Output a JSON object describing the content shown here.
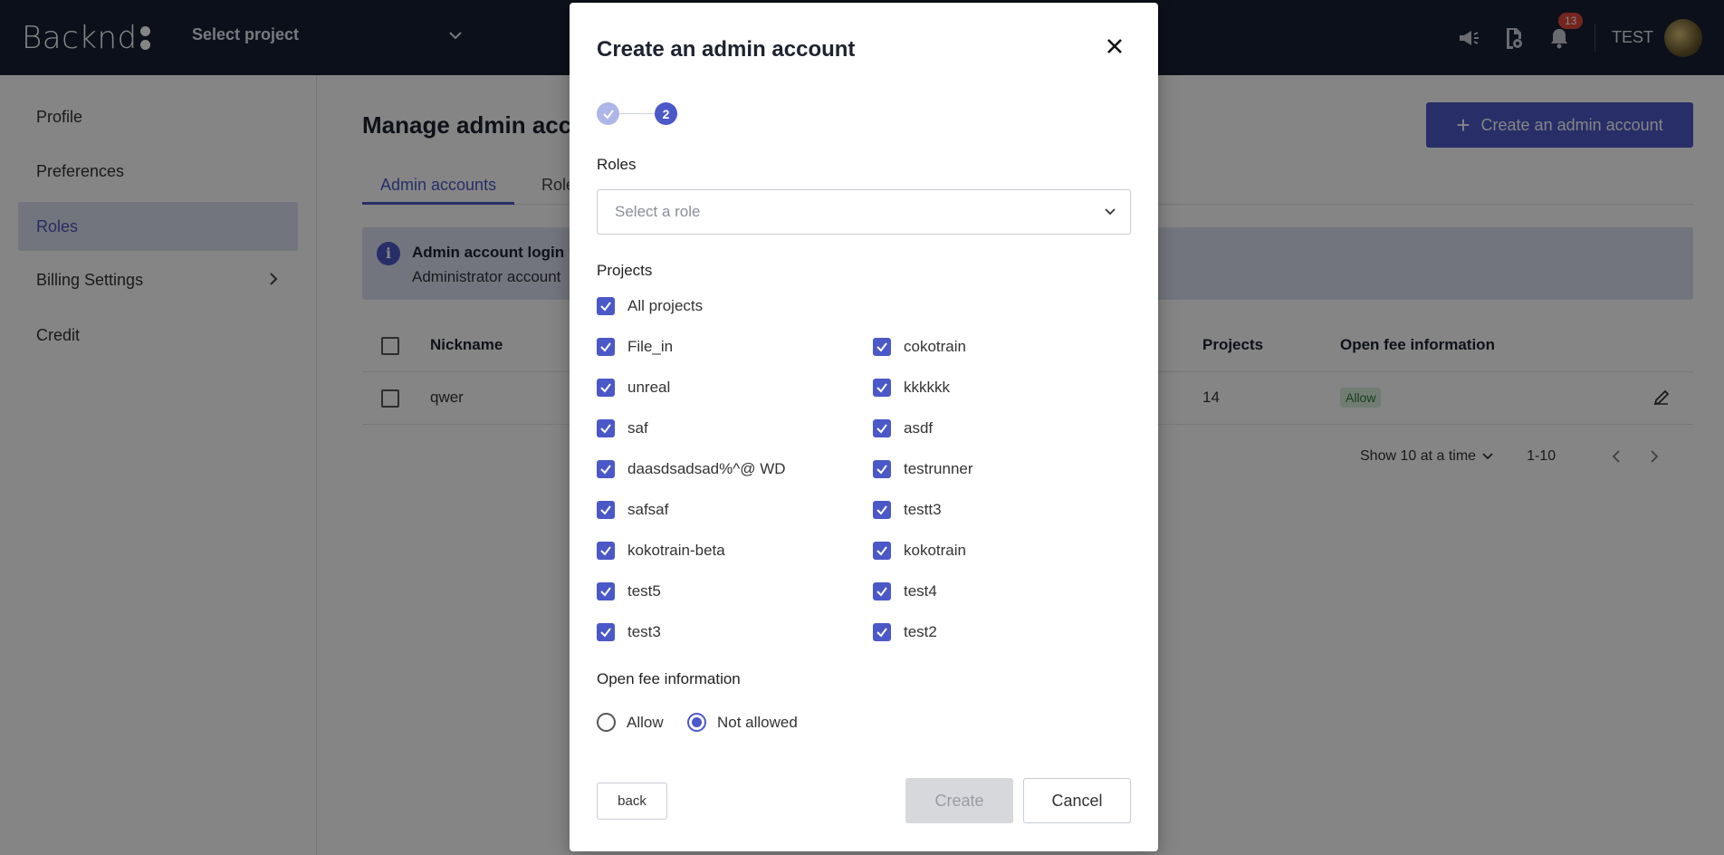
{
  "topbar": {
    "logo_text": "Backnd",
    "project_select": "Select project",
    "notification_count": "13",
    "user_name": "TEST"
  },
  "sidebar": {
    "items": [
      {
        "label": "Profile"
      },
      {
        "label": "Preferences"
      },
      {
        "label": "Roles"
      },
      {
        "label": "Billing Settings"
      },
      {
        "label": "Credit"
      }
    ]
  },
  "main": {
    "title": "Manage admin acco",
    "create_button": "Create an admin account",
    "tabs": [
      {
        "label": "Admin accounts"
      },
      {
        "label": "Role"
      }
    ],
    "notice": {
      "title": "Admin account login U",
      "text": "Administrator account"
    },
    "table": {
      "headers": [
        "Nickname",
        "Projects",
        "Open fee information"
      ],
      "row": {
        "nickname": "qwer",
        "projects": "14",
        "fee": "Allow"
      }
    },
    "pager": {
      "page_size": "Show 10 at a time",
      "range": "1-10"
    }
  },
  "modal": {
    "title": "Create an admin account",
    "current_step": "2",
    "roles_label": "Roles",
    "role_placeholder": "Select a role",
    "projects_label": "Projects",
    "all_projects": "All projects",
    "projects_left": [
      "File_in",
      "unreal",
      "saf",
      "daasdsadsad%^@ WD",
      "safsaf",
      "kokotrain-beta",
      "test5",
      "test3"
    ],
    "projects_right": [
      "cokotrain",
      "kkkkkk",
      "asdf",
      "testrunner",
      "testt3",
      "kokotrain",
      "test4",
      "test2"
    ],
    "fee_label": "Open fee information",
    "fee_options": [
      "Allow",
      "Not allowed"
    ],
    "back_button": "back",
    "create_button": "Create",
    "cancel_button": "Cancel"
  }
}
